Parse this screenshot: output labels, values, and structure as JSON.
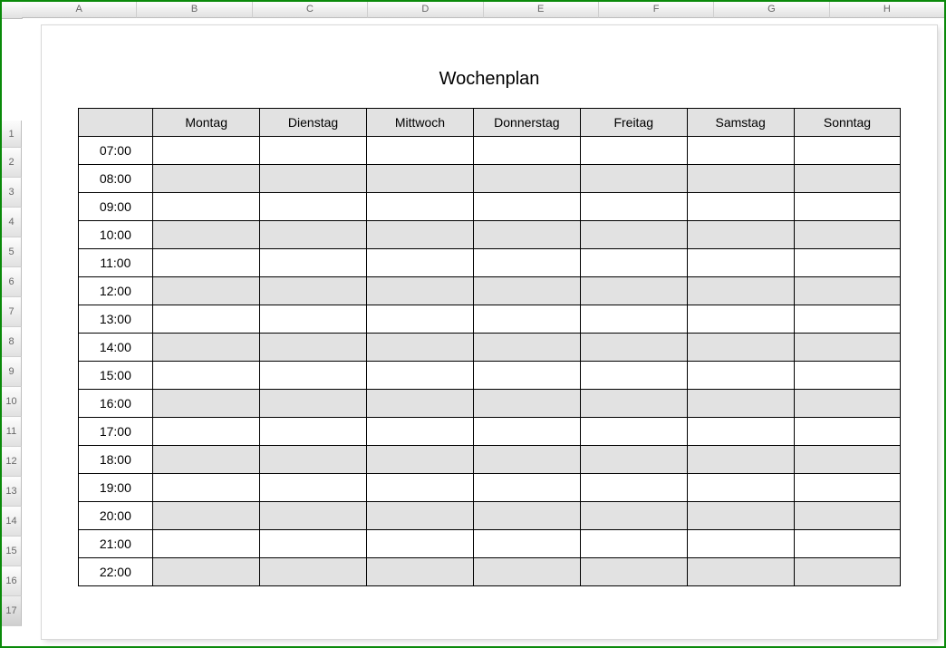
{
  "spreadsheet": {
    "columns": [
      "A",
      "B",
      "C",
      "D",
      "E",
      "F",
      "G",
      "H"
    ],
    "rows": [
      "1",
      "2",
      "3",
      "4",
      "5",
      "6",
      "7",
      "8",
      "9",
      "10",
      "11",
      "12",
      "13",
      "14",
      "15",
      "16",
      "17"
    ]
  },
  "document": {
    "title": "Wochenplan"
  },
  "table": {
    "days": [
      "Montag",
      "Dienstag",
      "Mittwoch",
      "Donnerstag",
      "Freitag",
      "Samstag",
      "Sonntag"
    ],
    "times": [
      "07:00",
      "08:00",
      "09:00",
      "10:00",
      "11:00",
      "12:00",
      "13:00",
      "14:00",
      "15:00",
      "16:00",
      "17:00",
      "18:00",
      "19:00",
      "20:00",
      "21:00",
      "22:00"
    ]
  }
}
